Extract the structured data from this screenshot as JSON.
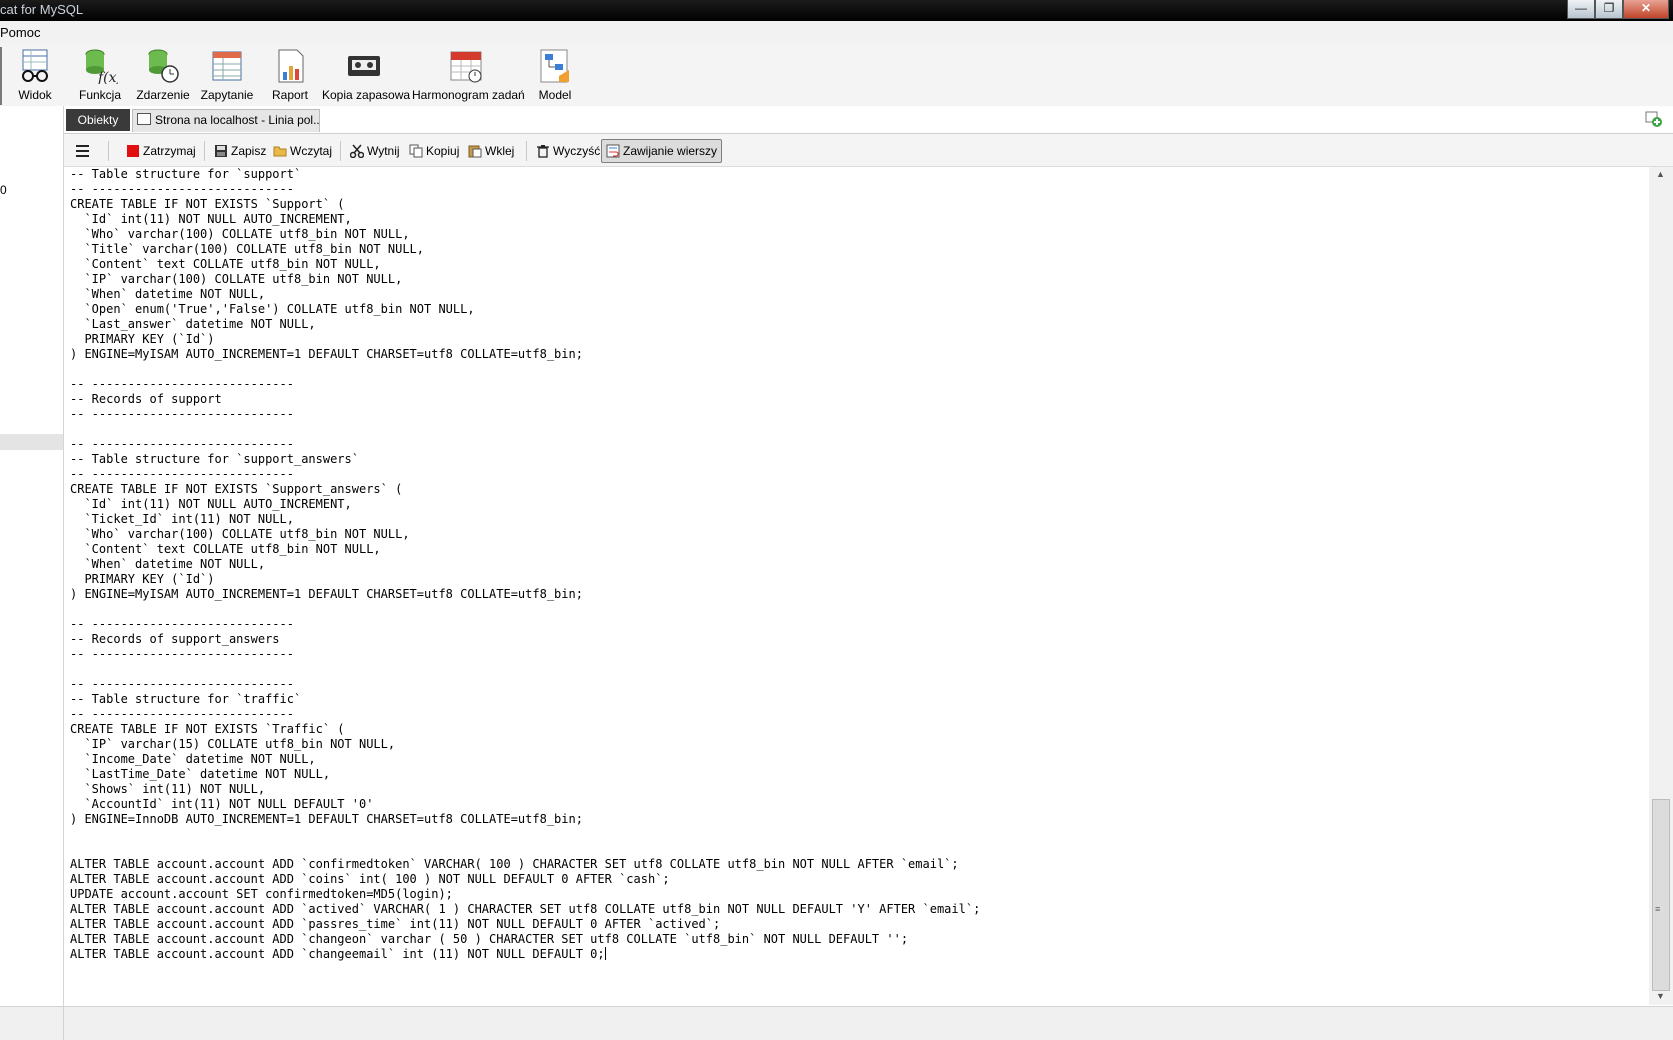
{
  "window": {
    "title": "cat for MySQL"
  },
  "menu": {
    "item": "Pomoc"
  },
  "toolbar": {
    "buttons": [
      {
        "id": "view",
        "label": "Widok",
        "icon": "glasses-table-icon"
      },
      {
        "id": "function",
        "label": "Funkcja",
        "icon": "function-db-icon"
      },
      {
        "id": "event",
        "label": "Zdarzenie",
        "icon": "event-clock-db-icon"
      },
      {
        "id": "query",
        "label": "Zapytanie",
        "icon": "query-table-icon"
      },
      {
        "id": "report",
        "label": "Raport",
        "icon": "report-chart-icon"
      },
      {
        "id": "backup",
        "label": "Kopia zapasowa",
        "icon": "backup-tape-icon"
      },
      {
        "id": "schedule",
        "label": "Harmonogram zadań",
        "icon": "calendar-clock-icon"
      },
      {
        "id": "model",
        "label": "Model",
        "icon": "model-diagram-icon"
      }
    ]
  },
  "tabs": {
    "objects": "Obiekty",
    "query_tab": "Strona na localhost  - Linia pol..."
  },
  "left_panel": {
    "value": "0"
  },
  "editor_toolbar": {
    "menu_icon": "hamburger-icon",
    "stop": "Zatrzymaj",
    "save": "Zapisz",
    "load": "Wczytaj",
    "cut": "Wytnij",
    "copy": "Kopiuj",
    "paste": "Wklej",
    "clear": "Wyczyść",
    "wrap": "Zawijanie wierszy"
  },
  "editor": {
    "lines": [
      "-- Table structure for `support`",
      "-- ----------------------------",
      "CREATE TABLE IF NOT EXISTS `Support` (",
      "  `Id` int(11) NOT NULL AUTO_INCREMENT,",
      "  `Who` varchar(100) COLLATE utf8_bin NOT NULL,",
      "  `Title` varchar(100) COLLATE utf8_bin NOT NULL,",
      "  `Content` text COLLATE utf8_bin NOT NULL,",
      "  `IP` varchar(100) COLLATE utf8_bin NOT NULL,",
      "  `When` datetime NOT NULL,",
      "  `Open` enum('True','False') COLLATE utf8_bin NOT NULL,",
      "  `Last_answer` datetime NOT NULL,",
      "  PRIMARY KEY (`Id`)",
      ") ENGINE=MyISAM AUTO_INCREMENT=1 DEFAULT CHARSET=utf8 COLLATE=utf8_bin;",
      "",
      "-- ----------------------------",
      "-- Records of support",
      "-- ----------------------------",
      "",
      "-- ----------------------------",
      "-- Table structure for `support_answers`",
      "-- ----------------------------",
      "CREATE TABLE IF NOT EXISTS `Support_answers` (",
      "  `Id` int(11) NOT NULL AUTO_INCREMENT,",
      "  `Ticket_Id` int(11) NOT NULL,",
      "  `Who` varchar(100) COLLATE utf8_bin NOT NULL,",
      "  `Content` text COLLATE utf8_bin NOT NULL,",
      "  `When` datetime NOT NULL,",
      "  PRIMARY KEY (`Id`)",
      ") ENGINE=MyISAM AUTO_INCREMENT=1 DEFAULT CHARSET=utf8 COLLATE=utf8_bin;",
      "",
      "-- ----------------------------",
      "-- Records of support_answers",
      "-- ----------------------------",
      "",
      "-- ----------------------------",
      "-- Table structure for `traffic`",
      "-- ----------------------------",
      "CREATE TABLE IF NOT EXISTS `Traffic` (",
      "  `IP` varchar(15) COLLATE utf8_bin NOT NULL,",
      "  `Income_Date` datetime NOT NULL,",
      "  `LastTime_Date` datetime NOT NULL,",
      "  `Shows` int(11) NOT NULL,",
      "  `AccountId` int(11) NOT NULL DEFAULT '0'",
      ") ENGINE=InnoDB AUTO_INCREMENT=1 DEFAULT CHARSET=utf8 COLLATE=utf8_bin;",
      "",
      "",
      "ALTER TABLE account.account ADD `confirmedtoken` VARCHAR( 100 ) CHARACTER SET utf8 COLLATE utf8_bin NOT NULL AFTER `email`;",
      "ALTER TABLE account.account ADD `coins` int( 100 ) NOT NULL DEFAULT 0 AFTER `cash`;",
      "UPDATE account.account SET confirmedtoken=MD5(login);",
      "ALTER TABLE account.account ADD `actived` VARCHAR( 1 ) CHARACTER SET utf8 COLLATE utf8_bin NOT NULL DEFAULT 'Y' AFTER `email`;",
      "ALTER TABLE account.account ADD `passres_time` int(11) NOT NULL DEFAULT 0 AFTER `actived`;",
      "ALTER TABLE account.account ADD `changeon` varchar ( 50 ) CHARACTER SET utf8 COLLATE `utf8_bin` NOT NULL DEFAULT '';",
      "ALTER TABLE account.account ADD `changeemail` int (11) NOT NULL DEFAULT 0;"
    ]
  },
  "colors": {
    "title_bar": "#000000",
    "objects_tab": "#3a3a3a",
    "stop_red": "#e01010"
  }
}
